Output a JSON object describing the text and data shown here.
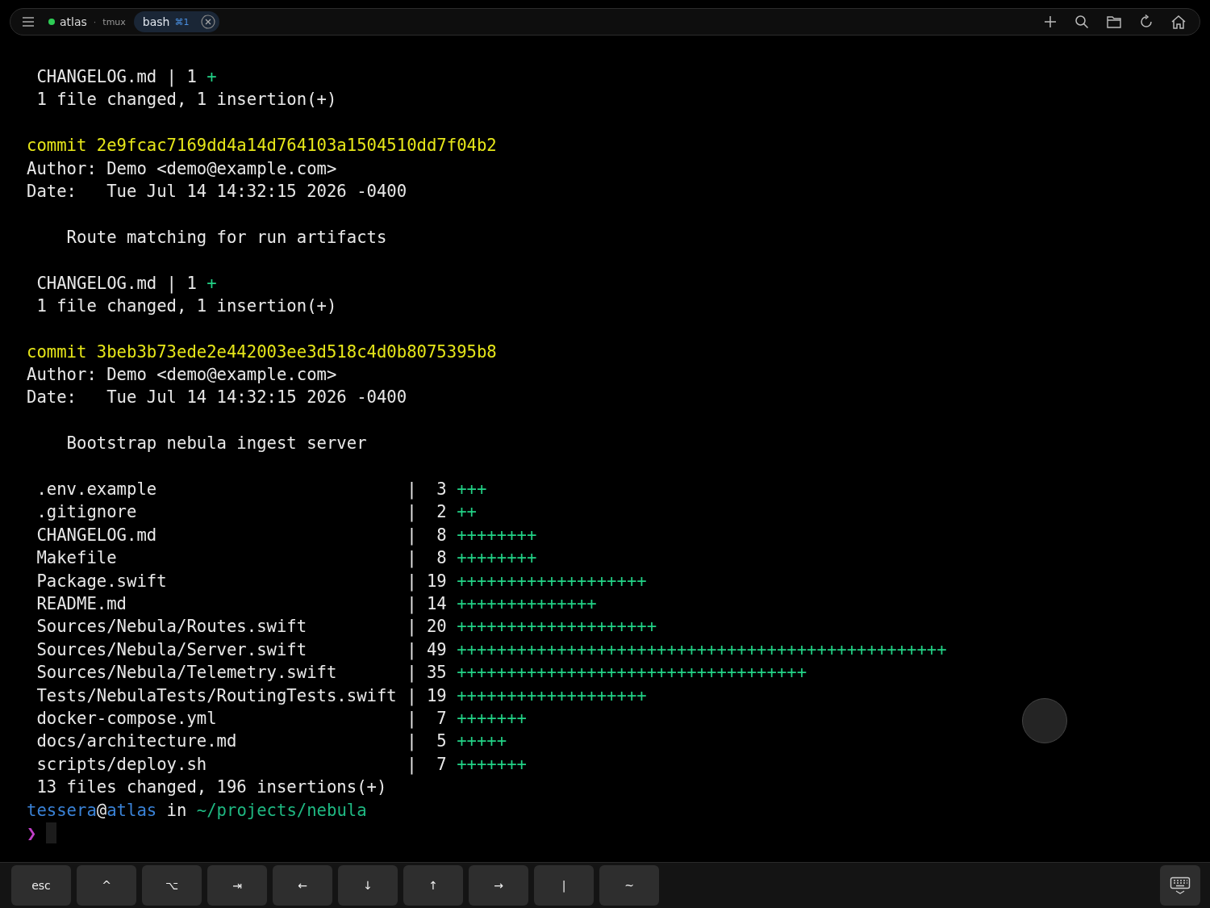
{
  "top_bar": {
    "host": "atlas",
    "separator": "·",
    "session": "tmux",
    "tabs": [
      {
        "label": "bash",
        "shortcut": "⌘1",
        "selected": true
      }
    ]
  },
  "terminal": {
    "lines": [
      {
        "kind": "text",
        "segments": [
          {
            "kind": "plain",
            "text": " CHANGELOG.md | 1 "
          },
          {
            "kind": "added",
            "text": "+"
          }
        ]
      },
      {
        "kind": "text",
        "segments": [
          {
            "kind": "plain",
            "text": " 1 file changed, 1 insertion(+)"
          }
        ]
      },
      {
        "kind": "blank"
      },
      {
        "kind": "text",
        "segments": [
          {
            "kind": "commit",
            "text": "commit 2e9fcac7169dd4a14d764103a1504510dd7f04b2"
          }
        ]
      },
      {
        "kind": "text",
        "segments": [
          {
            "kind": "plain",
            "text": "Author: Demo <demo@example.com>"
          }
        ]
      },
      {
        "kind": "text",
        "segments": [
          {
            "kind": "plain",
            "text": "Date:   Tue Jul 14 14:32:15 2026 -0400"
          }
        ]
      },
      {
        "kind": "blank"
      },
      {
        "kind": "text",
        "segments": [
          {
            "kind": "plain",
            "text": "    Route matching for run artifacts"
          }
        ]
      },
      {
        "kind": "blank"
      },
      {
        "kind": "text",
        "segments": [
          {
            "kind": "plain",
            "text": " CHANGELOG.md | 1 "
          },
          {
            "kind": "added",
            "text": "+"
          }
        ]
      },
      {
        "kind": "text",
        "segments": [
          {
            "kind": "plain",
            "text": " 1 file changed, 1 insertion(+)"
          }
        ]
      },
      {
        "kind": "blank"
      },
      {
        "kind": "text",
        "segments": [
          {
            "kind": "commit",
            "text": "commit 3beb3b73ede2e442003ee3d518c4d0b8075395b8"
          }
        ]
      },
      {
        "kind": "text",
        "segments": [
          {
            "kind": "plain",
            "text": "Author: Demo <demo@example.com>"
          }
        ]
      },
      {
        "kind": "text",
        "segments": [
          {
            "kind": "plain",
            "text": "Date:   Tue Jul 14 14:32:15 2026 -0400"
          }
        ]
      },
      {
        "kind": "blank"
      },
      {
        "kind": "text",
        "segments": [
          {
            "kind": "plain",
            "text": "    Bootstrap nebula ingest server"
          }
        ]
      },
      {
        "kind": "blank"
      },
      {
        "kind": "text",
        "segments": [
          {
            "kind": "plain",
            "text": " .env.example                         |  3 "
          },
          {
            "kind": "added",
            "text": "+++"
          }
        ]
      },
      {
        "kind": "text",
        "segments": [
          {
            "kind": "plain",
            "text": " .gitignore                           |  2 "
          },
          {
            "kind": "added",
            "text": "++"
          }
        ]
      },
      {
        "kind": "text",
        "segments": [
          {
            "kind": "plain",
            "text": " CHANGELOG.md                         |  8 "
          },
          {
            "kind": "added",
            "text": "++++++++"
          }
        ]
      },
      {
        "kind": "text",
        "segments": [
          {
            "kind": "plain",
            "text": " Makefile                             |  8 "
          },
          {
            "kind": "added",
            "text": "++++++++"
          }
        ]
      },
      {
        "kind": "text",
        "segments": [
          {
            "kind": "plain",
            "text": " Package.swift                        | 19 "
          },
          {
            "kind": "added",
            "text": "+++++++++++++++++++"
          }
        ]
      },
      {
        "kind": "text",
        "segments": [
          {
            "kind": "plain",
            "text": " README.md                            | 14 "
          },
          {
            "kind": "added",
            "text": "++++++++++++++"
          }
        ]
      },
      {
        "kind": "text",
        "segments": [
          {
            "kind": "plain",
            "text": " Sources/Nebula/Routes.swift          | 20 "
          },
          {
            "kind": "added",
            "text": "++++++++++++++++++++"
          }
        ]
      },
      {
        "kind": "text",
        "segments": [
          {
            "kind": "plain",
            "text": " Sources/Nebula/Server.swift          | 49 "
          },
          {
            "kind": "added",
            "text": "+++++++++++++++++++++++++++++++++++++++++++++++++"
          }
        ]
      },
      {
        "kind": "text",
        "segments": [
          {
            "kind": "plain",
            "text": " Sources/Nebula/Telemetry.swift       | 35 "
          },
          {
            "kind": "added",
            "text": "+++++++++++++++++++++++++++++++++++"
          }
        ]
      },
      {
        "kind": "text",
        "segments": [
          {
            "kind": "plain",
            "text": " Tests/NebulaTests/RoutingTests.swift | 19 "
          },
          {
            "kind": "added",
            "text": "+++++++++++++++++++"
          }
        ]
      },
      {
        "kind": "text",
        "segments": [
          {
            "kind": "plain",
            "text": " docker-compose.yml                   |  7 "
          },
          {
            "kind": "added",
            "text": "+++++++"
          }
        ]
      },
      {
        "kind": "text",
        "segments": [
          {
            "kind": "plain",
            "text": " docs/architecture.md                 |  5 "
          },
          {
            "kind": "added",
            "text": "+++++"
          }
        ]
      },
      {
        "kind": "text",
        "segments": [
          {
            "kind": "plain",
            "text": " scripts/deploy.sh                    |  7 "
          },
          {
            "kind": "added",
            "text": "+++++++"
          }
        ]
      },
      {
        "kind": "text",
        "segments": [
          {
            "kind": "plain",
            "text": " 13 files changed, 196 insertions(+)"
          }
        ]
      },
      {
        "kind": "text",
        "segments": [
          {
            "kind": "user",
            "text": "tessera"
          },
          {
            "kind": "plain",
            "text": "@"
          },
          {
            "kind": "user",
            "text": "atlas"
          },
          {
            "kind": "plain",
            "text": " in "
          },
          {
            "kind": "path",
            "text": "~/projects/nebula"
          }
        ]
      },
      {
        "kind": "prompt",
        "segments": [
          {
            "kind": "prompt",
            "text": "❯"
          }
        ]
      }
    ]
  },
  "keys": [
    "esc",
    "^",
    "⌥",
    "⇥",
    "←",
    "↓",
    "↑",
    "→",
    "|",
    "~"
  ]
}
